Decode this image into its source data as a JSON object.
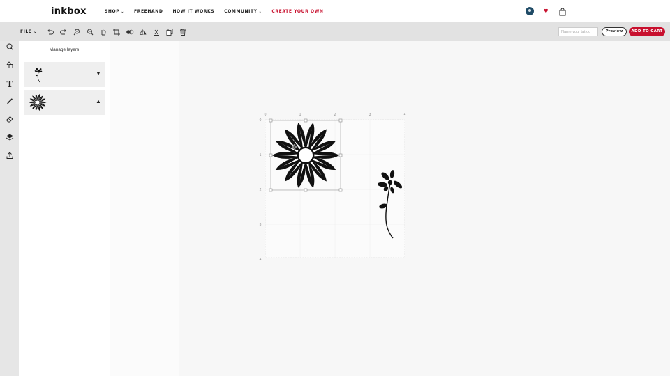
{
  "nav": {
    "logo": "inkbox",
    "links": [
      {
        "label": "SHOP",
        "caret": "⌄"
      },
      {
        "label": "FREEHAND",
        "caret": ""
      },
      {
        "label": "HOW IT WORKS",
        "caret": ""
      },
      {
        "label": "COMMUNITY",
        "caret": "⌄"
      },
      {
        "label": "CREATE YOUR OWN",
        "caret": ""
      }
    ],
    "heart": "♥"
  },
  "toolbar": {
    "file_label": "FILE",
    "file_caret": "⌄",
    "name_placeholder": "Name your tattoo",
    "preview_label": "Preview",
    "cart_label": "ADD TO CART",
    "icons": [
      "undo-icon",
      "redo-icon",
      "zoom-in-icon",
      "zoom-out-icon",
      "hand-icon",
      "crop-icon",
      "mask-icon",
      "flip-icon",
      "align-icon",
      "duplicate-icon",
      "trash-icon"
    ]
  },
  "rail": {
    "icons": [
      "search-icon",
      "shapes-icon",
      "text-icon",
      "pen-icon",
      "eraser-icon",
      "layers-icon",
      "upload-icon"
    ],
    "text_glyph": "T"
  },
  "layers": {
    "title": "Manage layers",
    "items": [
      {
        "name": "flower-stem-layer",
        "toggle": "▼"
      },
      {
        "name": "flower-burst-layer",
        "toggle": "▲"
      }
    ]
  },
  "canvas": {
    "ruler_x": [
      "0",
      "1",
      "2",
      "3",
      "4"
    ],
    "ruler_y": [
      "0",
      "1",
      "2",
      "3",
      "4"
    ]
  },
  "colors": {
    "accent": "#c8102e",
    "toolbar_bg": "#e2e2e2"
  }
}
